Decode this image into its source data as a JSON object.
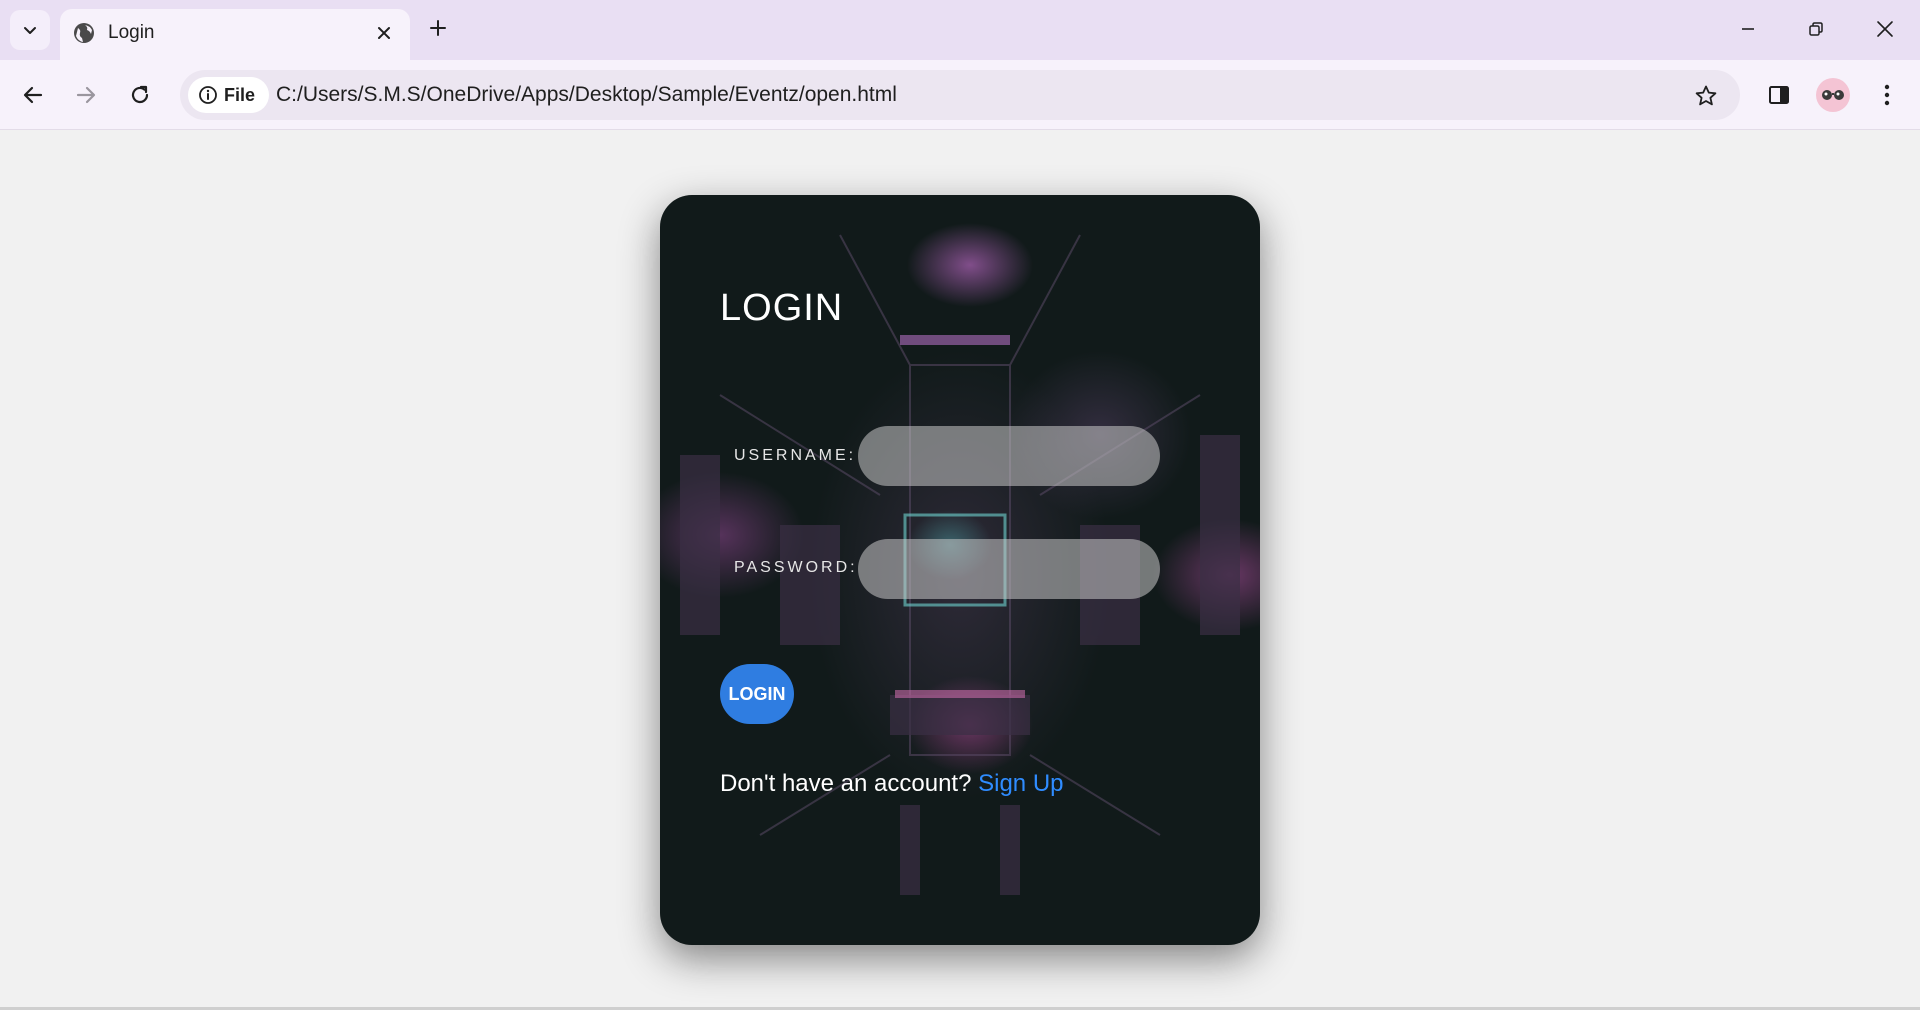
{
  "browser": {
    "tab": {
      "title": "Login"
    },
    "address_bar": {
      "chip_label": "File",
      "url": "C:/Users/S.M.S/OneDrive/Apps/Desktop/Sample/Eventz/open.html"
    },
    "icons": {
      "tab_search": "chevron-down-icon",
      "favicon": "globe-icon",
      "tab_close": "close-icon",
      "new_tab": "plus-icon",
      "minimize": "minimize-icon",
      "restore": "restore-icon",
      "close_window": "close-icon",
      "back": "arrow-left-icon",
      "forward": "arrow-right-icon",
      "reload": "reload-icon",
      "site_info": "info-icon",
      "bookmark": "star-icon",
      "side_panel": "side-panel-icon",
      "profile": "profile-avatar-icon",
      "menu": "kebab-menu-icon"
    }
  },
  "login_card": {
    "title": "LOGIN",
    "username": {
      "label": "USERNAME:",
      "value": "",
      "placeholder": ""
    },
    "password": {
      "label": "PASSWORD:",
      "value": "",
      "placeholder": ""
    },
    "login_button": "LOGIN",
    "signup_prompt": "Don't have an account?",
    "signup_link": "Sign Up"
  },
  "colors": {
    "tab_strip": "#e9dff3",
    "toolbar": "#f7f2fb",
    "page_background": "#f1f1f1",
    "card_background": "#111a1a",
    "login_button": "#2f7de1",
    "signup_link": "#2f8cff",
    "text_light": "#ffffff"
  }
}
